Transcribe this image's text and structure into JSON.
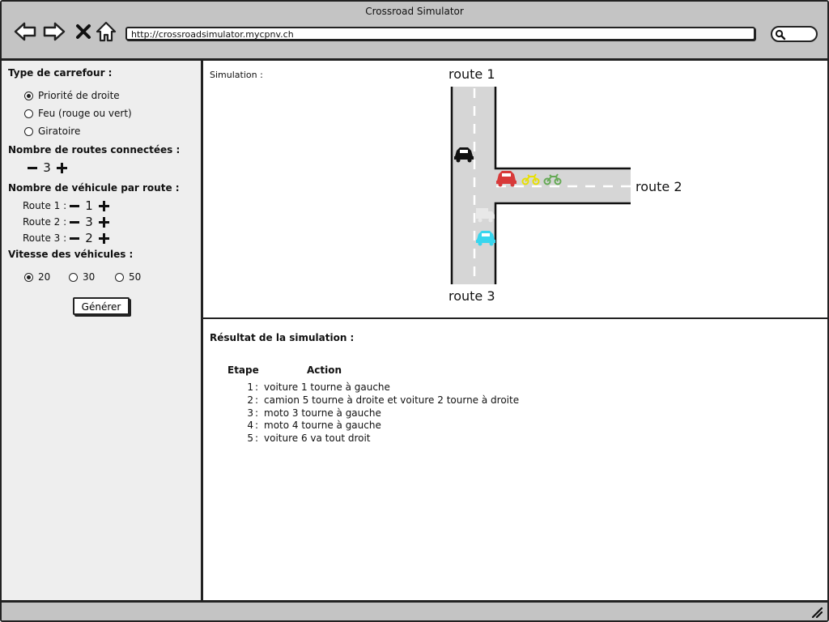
{
  "window": {
    "title": "Crossroad Simulator",
    "url": "http://crossroadsimulator.mycpnv.ch"
  },
  "icons": {
    "back": "arrow-left-icon",
    "forward": "arrow-right-icon",
    "stop": "close-icon",
    "home": "home-icon",
    "search": "search-icon",
    "resize": "resize-grip-icon"
  },
  "sidebar": {
    "crossroad_type": {
      "heading": "Type de carrefour :",
      "options": [
        "Priorité de droite",
        "Feu (rouge ou vert)",
        "Giratoire"
      ],
      "selected": 0
    },
    "connected_roads": {
      "heading": "Nombre de routes connectées :",
      "value": "3"
    },
    "vehicles_per_road": {
      "heading": "Nombre de véhicule par route :",
      "routes": [
        {
          "label": "Route 1 :",
          "value": "1"
        },
        {
          "label": "Route 2 :",
          "value": "3"
        },
        {
          "label": "Route 3 :",
          "value": "2"
        }
      ]
    },
    "speed": {
      "heading": "Vitesse des véhicules :",
      "options": [
        "20",
        "30",
        "50"
      ],
      "selected": 0
    },
    "generate_label": "Générer"
  },
  "simulation": {
    "label": "Simulation :",
    "routes": [
      "route 1",
      "route 2",
      "route 3"
    ],
    "vehicles": [
      {
        "type": "car",
        "color": "#111111"
      },
      {
        "type": "car",
        "color": "#d83a3a"
      },
      {
        "type": "motorbike",
        "color": "#e8e000"
      },
      {
        "type": "motorbike",
        "color": "#66aa55"
      },
      {
        "type": "truck",
        "color": "#e4e4e4"
      },
      {
        "type": "car",
        "color": "#38d6ee"
      }
    ]
  },
  "results": {
    "title": "Résultat de la simulation :",
    "col_step": "Etape",
    "col_action": "Action",
    "rows": [
      {
        "step": "1",
        "action": "voiture 1 tourne à gauche"
      },
      {
        "step": "2",
        "action": "camion 5 tourne à droite et voiture 2 tourne à droite"
      },
      {
        "step": "3",
        "action": "moto 3 tourne à gauche"
      },
      {
        "step": "4",
        "action": "moto 4 tourne à gauche"
      },
      {
        "step": "5",
        "action": "voiture 6 va tout droit"
      }
    ]
  },
  "colors": {
    "chrome": "#c4c4c4",
    "sidebar": "#eeeeee",
    "road": "#d6d6d6",
    "border": "#222222"
  }
}
